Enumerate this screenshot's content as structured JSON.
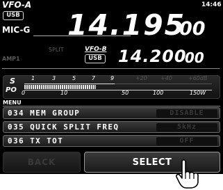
{
  "header": {
    "vfo_label": "VFO-A",
    "mode_badge": "USB",
    "clock": "14:46",
    "mic_label": "MIC-G",
    "main_freq_big": "14.195",
    "main_freq_small": "00"
  },
  "sub": {
    "amp_label": "AMP1",
    "split_label": "SPLIT",
    "vfo_label": "VFO-B",
    "mode_badge": "USB",
    "freq_big": "14.200",
    "freq_small": "00"
  },
  "meter": {
    "s_label": "S",
    "po_label": "PO",
    "s_scale": [
      "1",
      "3",
      "5",
      "7",
      "9",
      "+20",
      "+40",
      "+60dB"
    ],
    "po_scale": [
      "0",
      "10",
      "50",
      "100",
      "150W"
    ],
    "po_level_fraction": 0.38
  },
  "menu": {
    "title": "MENU",
    "items": [
      {
        "name": "034 MEM GROUP",
        "value": "DISABLE"
      },
      {
        "name": "035 QUICK SPLIT FREQ",
        "value": "5kHz"
      },
      {
        "name": "036 TX TOT",
        "value": "OFF"
      }
    ]
  },
  "buttons": {
    "back_label": "BACK",
    "select_label": "SELECT"
  },
  "colors": {
    "background": "#000000",
    "text": "#ffffff",
    "dim_text": "#5a5a5a",
    "scale_inactive": "#555555"
  },
  "icons": {
    "pointer": "hand-pointer-icon"
  }
}
